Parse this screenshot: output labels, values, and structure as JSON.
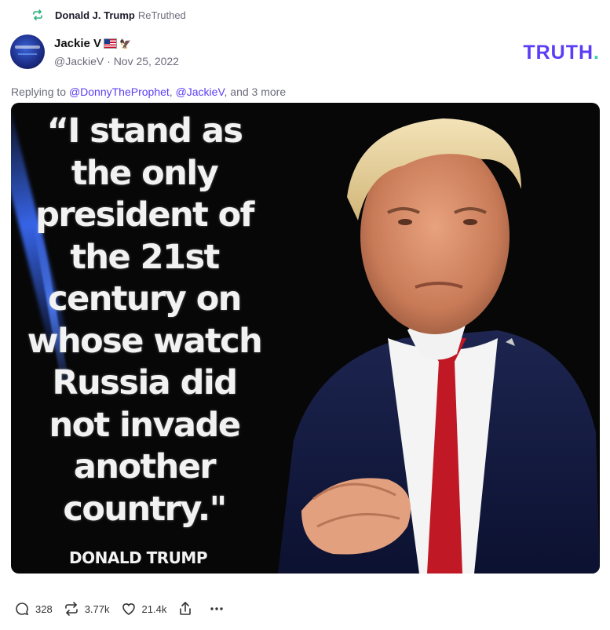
{
  "retruth": {
    "name": "Donald J. Trump",
    "suffix": "ReTruthed",
    "icon": "retruth-icon"
  },
  "post": {
    "author_name": "Jackie V",
    "author_handle": "@JackieV",
    "date": "Nov 25, 2022",
    "separator": "·",
    "flag_icon": "us-flag-icon",
    "eagle_icon": "eagle-icon"
  },
  "brand": {
    "logo_text": "TRUTH",
    "logo_dot": ".",
    "colors": {
      "accent": "#5b3df5",
      "dot": "#2ad5b0"
    }
  },
  "reply": {
    "prefix": "Replying to ",
    "mentions": [
      "@DonnyTheProphet",
      "@JackieV"
    ],
    "comma": ", ",
    "suffix": ", and 3 more"
  },
  "media": {
    "quote": "“I stand as\nthe only\npresident of\nthe 21st\ncentury on\nwhose watch\nRussia did\nnot invade\nanother\ncountry.\"",
    "attribution": "DONALD TRUMP"
  },
  "actions": {
    "replies": "328",
    "retruths": "3.77k",
    "likes": "21.4k",
    "icons": [
      "reply-icon",
      "retruth-icon",
      "like-icon",
      "share-icon",
      "more-icon"
    ]
  }
}
